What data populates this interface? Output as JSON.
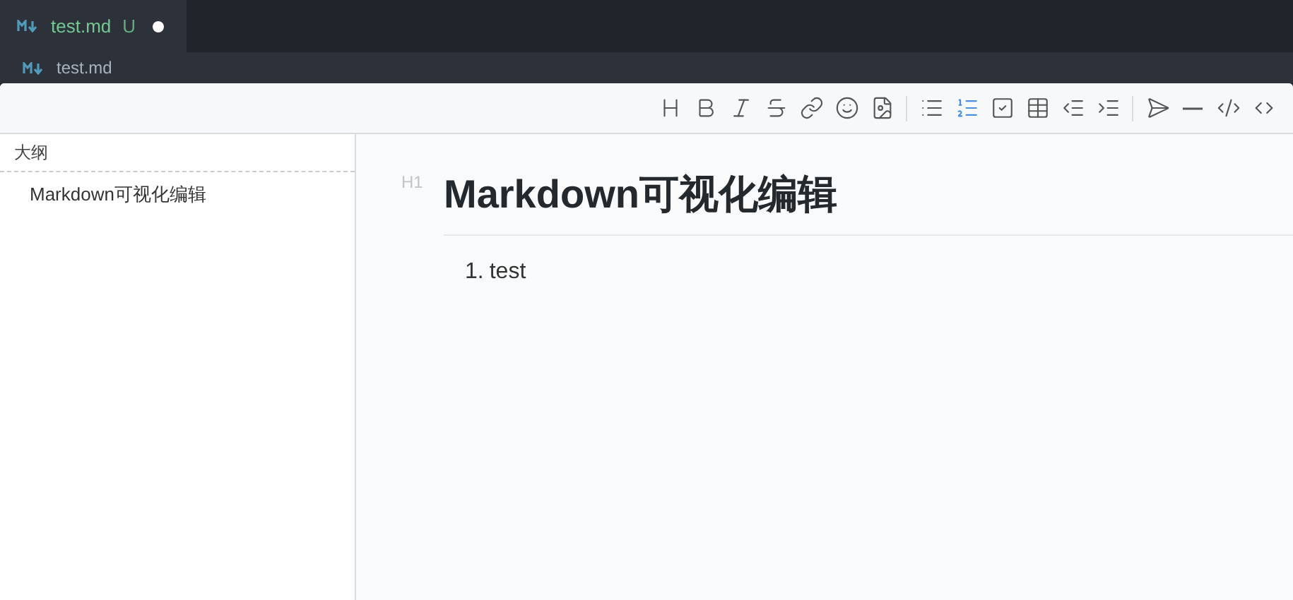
{
  "tab": {
    "label": "test.md",
    "status": "U",
    "modified": true,
    "selected": true
  },
  "breadcrumb": {
    "label": "test.md"
  },
  "toolbar": {
    "groups": [
      [
        {
          "kind": "heading",
          "selected": false
        },
        {
          "kind": "bold",
          "selected": false
        },
        {
          "kind": "italic",
          "selected": false
        },
        {
          "kind": "strike",
          "selected": false
        },
        {
          "kind": "link",
          "selected": false
        },
        {
          "kind": "emoji",
          "selected": false
        },
        {
          "kind": "image",
          "selected": false
        }
      ],
      [
        {
          "kind": "bullet-list",
          "selected": false
        },
        {
          "kind": "ordered-list",
          "selected": true
        },
        {
          "kind": "task",
          "selected": false
        },
        {
          "kind": "table",
          "selected": false
        },
        {
          "kind": "outdent",
          "selected": false
        },
        {
          "kind": "indent",
          "selected": false
        }
      ],
      [
        {
          "kind": "quote",
          "selected": false
        },
        {
          "kind": "rule",
          "selected": false
        },
        {
          "kind": "inline-code",
          "selected": false
        },
        {
          "kind": "code-block",
          "selected": false
        }
      ]
    ]
  },
  "outline": {
    "title": "大纲",
    "items": [
      {
        "label": "Markdown可视化编辑"
      }
    ]
  },
  "document": {
    "heading": {
      "level": "H1",
      "text": "Markdown可视化编辑"
    },
    "list": [
      {
        "number": "1.",
        "text": "test"
      }
    ]
  }
}
